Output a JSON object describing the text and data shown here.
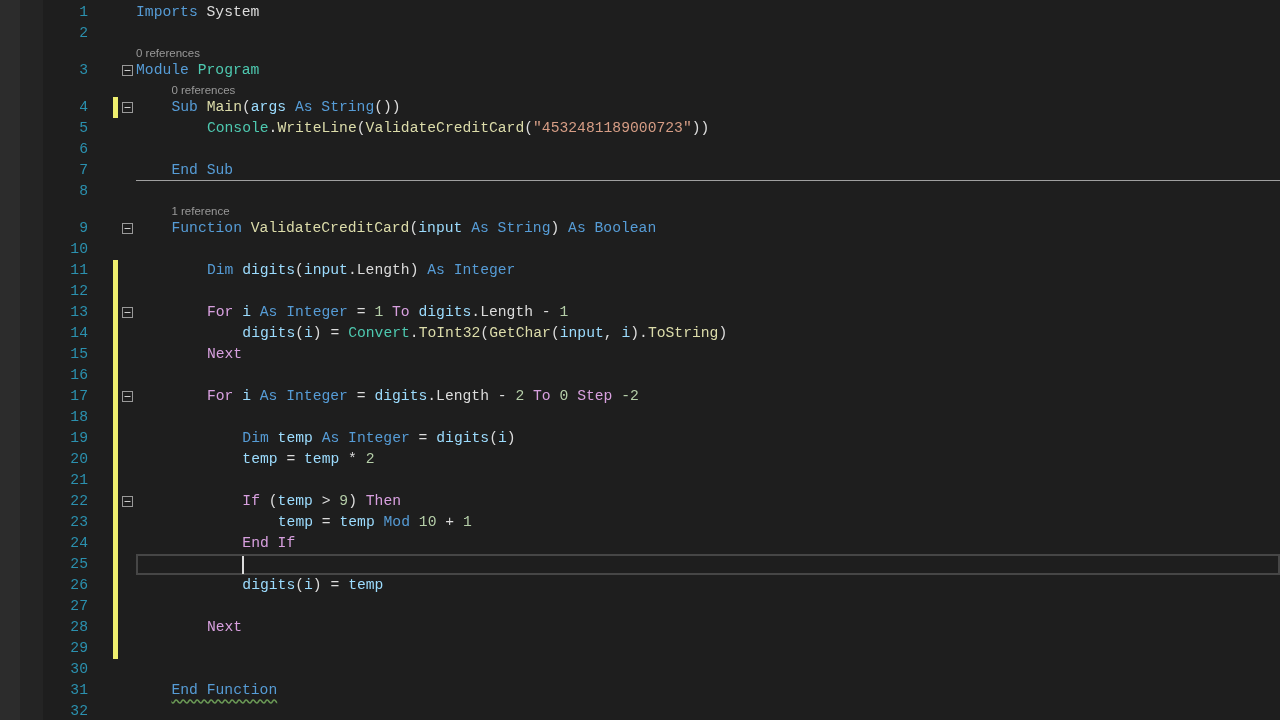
{
  "editor": {
    "lines": [
      {
        "number": "1",
        "modified": false,
        "foldable": false,
        "current": false,
        "separator": false,
        "tokens": [
          {
            "kind": "keyword",
            "text": "Imports "
          },
          {
            "kind": "plain",
            "text": "System"
          }
        ]
      },
      {
        "number": "2",
        "modified": false,
        "foldable": false,
        "current": false,
        "separator": false
      },
      {
        "number": "3",
        "codelens": "0 references",
        "modified": false,
        "foldable": true,
        "current": false,
        "separator": false,
        "tokens": [
          {
            "kind": "keyword",
            "text": "Module "
          },
          {
            "kind": "type",
            "text": "Program"
          }
        ],
        "children": [
          {
            "number": "4",
            "codelens": "0 references",
            "modified": true,
            "foldable": true,
            "current": false,
            "separator": false,
            "tokens": [
              {
                "kind": "keyword",
                "text": "Sub "
              },
              {
                "kind": "method",
                "text": "Main"
              },
              {
                "kind": "plain",
                "text": "("
              },
              {
                "kind": "ident",
                "text": "args "
              },
              {
                "kind": "keyword",
                "text": "As String"
              },
              {
                "kind": "plain",
                "text": "())"
              }
            ],
            "children": [
              {
                "number": "5",
                "modified": false,
                "foldable": false,
                "current": false,
                "separator": false,
                "tokens": [
                  {
                    "kind": "type",
                    "text": "Console"
                  },
                  {
                    "kind": "plain",
                    "text": "."
                  },
                  {
                    "kind": "method",
                    "text": "WriteLine"
                  },
                  {
                    "kind": "plain",
                    "text": "("
                  },
                  {
                    "kind": "method",
                    "text": "ValidateCreditCard"
                  },
                  {
                    "kind": "plain",
                    "text": "("
                  },
                  {
                    "kind": "string",
                    "text": "\"4532481189000723\""
                  },
                  {
                    "kind": "plain",
                    "text": "))"
                  }
                ]
              },
              {
                "number": "6",
                "modified": false,
                "foldable": false,
                "current": false,
                "separator": false
              }
            ]
          },
          {
            "number": "7",
            "modified": false,
            "foldable": false,
            "current": false,
            "separator": true,
            "tokens": [
              {
                "kind": "keyword",
                "text": "End Sub"
              }
            ]
          },
          {
            "number": "8",
            "modified": false,
            "foldable": false,
            "current": false,
            "separator": false
          },
          {
            "number": "9",
            "codelens": "1 reference",
            "modified": false,
            "foldable": true,
            "current": false,
            "separator": false,
            "tokens": [
              {
                "kind": "keyword",
                "text": "Function "
              },
              {
                "kind": "method",
                "text": "ValidateCreditCard"
              },
              {
                "kind": "plain",
                "text": "("
              },
              {
                "kind": "ident",
                "text": "input "
              },
              {
                "kind": "keyword",
                "text": "As String"
              },
              {
                "kind": "plain",
                "text": ") "
              },
              {
                "kind": "keyword",
                "text": "As Boolean"
              }
            ],
            "children": [
              {
                "number": "10",
                "modified": false,
                "foldable": false,
                "current": false,
                "separator": false
              },
              {
                "number": "11",
                "modified": true,
                "foldable": false,
                "current": false,
                "separator": false,
                "tokens": [
                  {
                    "kind": "keyword",
                    "text": "Dim "
                  },
                  {
                    "kind": "ident",
                    "text": "digits"
                  },
                  {
                    "kind": "plain",
                    "text": "("
                  },
                  {
                    "kind": "ident",
                    "text": "input"
                  },
                  {
                    "kind": "plain",
                    "text": ".Length) "
                  },
                  {
                    "kind": "keyword",
                    "text": "As Integer"
                  }
                ]
              },
              {
                "number": "12",
                "modified": true,
                "foldable": false,
                "current": false,
                "separator": false
              },
              {
                "number": "13",
                "modified": true,
                "foldable": true,
                "current": false,
                "separator": false,
                "tokens": [
                  {
                    "kind": "control",
                    "text": "For "
                  },
                  {
                    "kind": "ident",
                    "text": "i "
                  },
                  {
                    "kind": "keyword",
                    "text": "As Integer"
                  },
                  {
                    "kind": "plain",
                    "text": " = "
                  },
                  {
                    "kind": "number",
                    "text": "1 "
                  },
                  {
                    "kind": "control",
                    "text": "To "
                  },
                  {
                    "kind": "ident",
                    "text": "digits"
                  },
                  {
                    "kind": "plain",
                    "text": ".Length - "
                  },
                  {
                    "kind": "number",
                    "text": "1"
                  }
                ],
                "children": [
                  {
                    "number": "14",
                    "modified": true,
                    "foldable": false,
                    "current": false,
                    "separator": false,
                    "tokens": [
                      {
                        "kind": "ident",
                        "text": "digits"
                      },
                      {
                        "kind": "plain",
                        "text": "("
                      },
                      {
                        "kind": "ident",
                        "text": "i"
                      },
                      {
                        "kind": "plain",
                        "text": ") = "
                      },
                      {
                        "kind": "type",
                        "text": "Convert"
                      },
                      {
                        "kind": "plain",
                        "text": "."
                      },
                      {
                        "kind": "method",
                        "text": "ToInt32"
                      },
                      {
                        "kind": "plain",
                        "text": "("
                      },
                      {
                        "kind": "method",
                        "text": "GetChar"
                      },
                      {
                        "kind": "plain",
                        "text": "("
                      },
                      {
                        "kind": "ident",
                        "text": "input"
                      },
                      {
                        "kind": "plain",
                        "text": ", "
                      },
                      {
                        "kind": "ident",
                        "text": "i"
                      },
                      {
                        "kind": "plain",
                        "text": ")."
                      },
                      {
                        "kind": "method",
                        "text": "ToString"
                      },
                      {
                        "kind": "plain",
                        "text": ")"
                      }
                    ]
                  }
                ]
              },
              {
                "number": "15",
                "modified": true,
                "foldable": false,
                "current": false,
                "separator": false,
                "tokens": [
                  {
                    "kind": "control",
                    "text": "Next"
                  }
                ]
              },
              {
                "number": "16",
                "modified": true,
                "foldable": false,
                "current": false,
                "separator": false
              },
              {
                "number": "17",
                "modified": true,
                "foldable": true,
                "current": false,
                "separator": false,
                "tokens": [
                  {
                    "kind": "control",
                    "text": "For "
                  },
                  {
                    "kind": "ident",
                    "text": "i "
                  },
                  {
                    "kind": "keyword",
                    "text": "As Integer"
                  },
                  {
                    "kind": "plain",
                    "text": " = "
                  },
                  {
                    "kind": "ident",
                    "text": "digits"
                  },
                  {
                    "kind": "plain",
                    "text": ".Length - "
                  },
                  {
                    "kind": "number",
                    "text": "2 "
                  },
                  {
                    "kind": "control",
                    "text": "To "
                  },
                  {
                    "kind": "number",
                    "text": "0 "
                  },
                  {
                    "kind": "control",
                    "text": "Step "
                  },
                  {
                    "kind": "number",
                    "text": "-2"
                  }
                ],
                "children": [
                  {
                    "number": "18",
                    "modified": true,
                    "foldable": false,
                    "current": false,
                    "separator": false
                  },
                  {
                    "number": "19",
                    "modified": true,
                    "foldable": false,
                    "current": false,
                    "separator": false,
                    "tokens": [
                      {
                        "kind": "keyword",
                        "text": "Dim "
                      },
                      {
                        "kind": "ident",
                        "text": "temp "
                      },
                      {
                        "kind": "keyword",
                        "text": "As Integer"
                      },
                      {
                        "kind": "plain",
                        "text": " = "
                      },
                      {
                        "kind": "ident",
                        "text": "digits"
                      },
                      {
                        "kind": "plain",
                        "text": "("
                      },
                      {
                        "kind": "ident",
                        "text": "i"
                      },
                      {
                        "kind": "plain",
                        "text": ")"
                      }
                    ]
                  },
                  {
                    "number": "20",
                    "modified": true,
                    "foldable": false,
                    "current": false,
                    "separator": false,
                    "tokens": [
                      {
                        "kind": "ident",
                        "text": "temp"
                      },
                      {
                        "kind": "plain",
                        "text": " = "
                      },
                      {
                        "kind": "ident",
                        "text": "temp"
                      },
                      {
                        "kind": "plain",
                        "text": " * "
                      },
                      {
                        "kind": "number",
                        "text": "2"
                      }
                    ]
                  },
                  {
                    "number": "21",
                    "modified": true,
                    "foldable": false,
                    "current": false,
                    "separator": false
                  },
                  {
                    "number": "22",
                    "modified": true,
                    "foldable": true,
                    "current": false,
                    "separator": false,
                    "tokens": [
                      {
                        "kind": "control",
                        "text": "If"
                      },
                      {
                        "kind": "plain",
                        "text": " ("
                      },
                      {
                        "kind": "ident",
                        "text": "temp"
                      },
                      {
                        "kind": "plain",
                        "text": " > "
                      },
                      {
                        "kind": "number",
                        "text": "9"
                      },
                      {
                        "kind": "plain",
                        "text": ") "
                      },
                      {
                        "kind": "control",
                        "text": "Then"
                      }
                    ],
                    "children": [
                      {
                        "number": "23",
                        "modified": true,
                        "foldable": false,
                        "current": false,
                        "separator": false,
                        "tokens": [
                          {
                            "kind": "ident",
                            "text": "temp"
                          },
                          {
                            "kind": "plain",
                            "text": " = "
                          },
                          {
                            "kind": "ident",
                            "text": "temp "
                          },
                          {
                            "kind": "keyword",
                            "text": "Mod "
                          },
                          {
                            "kind": "number",
                            "text": "10"
                          },
                          {
                            "kind": "plain",
                            "text": " + "
                          },
                          {
                            "kind": "number",
                            "text": "1"
                          }
                        ]
                      }
                    ]
                  },
                  {
                    "number": "24",
                    "modified": true,
                    "foldable": false,
                    "current": false,
                    "separator": false,
                    "tokens": [
                      {
                        "kind": "control",
                        "text": "End If"
                      }
                    ]
                  },
                  {
                    "number": "25",
                    "modified": true,
                    "foldable": false,
                    "current": true,
                    "separator": false
                  },
                  {
                    "number": "26",
                    "modified": true,
                    "foldable": false,
                    "current": false,
                    "separator": false,
                    "tokens": [
                      {
                        "kind": "ident",
                        "text": "digits"
                      },
                      {
                        "kind": "plain",
                        "text": "("
                      },
                      {
                        "kind": "ident",
                        "text": "i"
                      },
                      {
                        "kind": "plain",
                        "text": ") = "
                      },
                      {
                        "kind": "ident",
                        "text": "temp"
                      }
                    ]
                  },
                  {
                    "number": "27",
                    "modified": true,
                    "foldable": false,
                    "current": false,
                    "separator": false
                  }
                ]
              },
              {
                "number": "28",
                "modified": true,
                "foldable": false,
                "current": false,
                "separator": false,
                "tokens": [
                  {
                    "kind": "control",
                    "text": "Next"
                  }
                ]
              },
              {
                "number": "29",
                "modified": true,
                "foldable": false,
                "current": false,
                "separator": false
              },
              {
                "number": "30",
                "modified": false,
                "foldable": false,
                "current": false,
                "separator": false
              }
            ]
          },
          {
            "number": "31",
            "modified": false,
            "foldable": false,
            "current": false,
            "separator": false,
            "tokens": [
              {
                "kind": "keyword",
                "text": "End Function",
                "squiggle": true
              }
            ]
          },
          {
            "number": "32",
            "modified": false,
            "foldable": false,
            "current": false,
            "separator": false
          }
        ]
      }
    ]
  }
}
